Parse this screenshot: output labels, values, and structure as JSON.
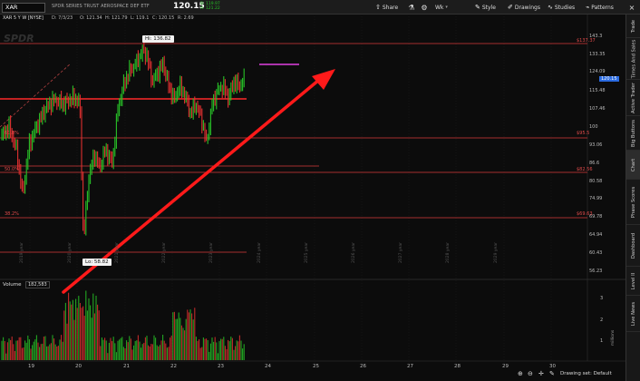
{
  "toolbar": {
    "symbol": "XAR",
    "company_name": "SPDR SERIES TRUST AEROSPACE DEF ETF",
    "last_price": "120.15",
    "change": [
      "B: 119.97",
      "A: 121.22"
    ],
    "share_label": "Share",
    "interval_label": "Wk",
    "style_label": "Style",
    "drawings_label": "Drawings",
    "studies_label": "Studies",
    "patterns_label": "Patterns"
  },
  "chart_header": {
    "description": "XAR 5 Y W [NYSE]",
    "date": "D: 7/3/23",
    "open": "O: 121.34",
    "high": "H: 121.79",
    "low": "L: 119.1",
    "close": "C: 120.15",
    "range": "R: 2.69"
  },
  "y_axis_labels": [
    "143.3",
    "133.35",
    "124.09",
    "115.48",
    "107.46",
    "100",
    "93.06",
    "86.6",
    "80.58",
    "74.99",
    "69.78",
    "64.94",
    "60.43",
    "56.23"
  ],
  "x_axis_labels": [
    "19",
    "20",
    "21",
    "22",
    "23",
    "24",
    "25",
    "26",
    "27",
    "28",
    "29",
    "30"
  ],
  "year_marks": [
    "2019 year",
    "2020 year",
    "2021 year",
    "2022 year",
    "2023 year",
    "2024 year",
    "2025 year",
    "2026 year",
    "2027 year",
    "2028 year",
    "2029 year"
  ],
  "fib_labels_right": [
    "$137.37",
    "$95.5",
    "$82.56",
    "$69.63"
  ],
  "fib_labels_left": [
    "61.8%",
    "50.0%",
    "38.2%"
  ],
  "hi_label": "Hi: 136.82",
  "lo_label": "Lo: 58.82",
  "current_price_tag": "120.15",
  "volume": {
    "label": "Volume",
    "value": "182,583",
    "y_labels": [
      "3",
      "2",
      "1"
    ],
    "y_unit": "millions"
  },
  "side_tabs": [
    "Trade",
    "Times And Sales",
    "Active Trader",
    "Big Buttons",
    "Chart",
    "Phase Scores",
    "Dashboard",
    "Level II",
    "Live News"
  ],
  "footer": {
    "drawing_set": "Drawing set: Default"
  },
  "colors": {
    "background": "#0c0c0c",
    "up_bar": "#27c227",
    "down_bar": "#e03030",
    "fib_line": "#d83a3a",
    "arrow": "#ff1a1a",
    "magenta_line": "#e040e0",
    "price_tag": "#2b6be0"
  },
  "icons": [
    "share-icon",
    "flask-icon",
    "gear-icon",
    "style-icon",
    "drawings-icon",
    "studies-icon",
    "patterns-icon",
    "close-icon",
    "zoom-in-icon",
    "zoom-out-icon",
    "crosshair-icon"
  ]
}
